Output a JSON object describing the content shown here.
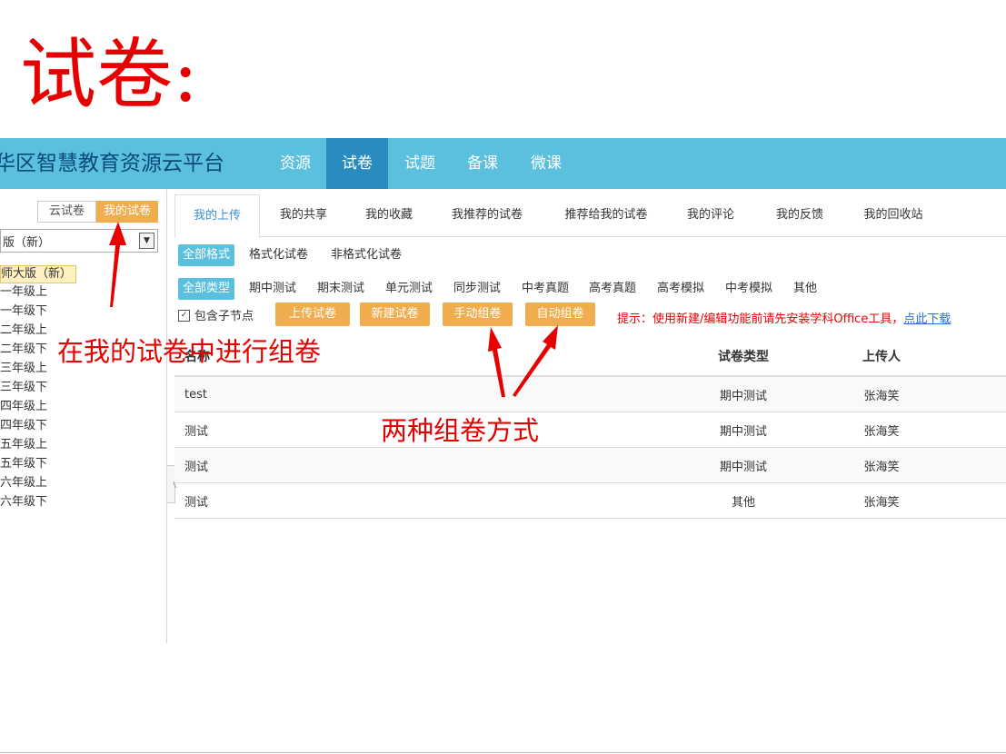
{
  "slide_title": "试卷:",
  "navbar": {
    "brand": "华区智慧教育资源云平台",
    "items": [
      "资源",
      "试卷",
      "试题",
      "备课",
      "微课"
    ],
    "active": "试卷"
  },
  "left_panel": {
    "seg_cloud": "云试卷",
    "seg_mine": "我的试卷",
    "version_select": "版（新）",
    "tree_root": "师大版（新）",
    "tree_items": [
      "一年级上",
      "一年级下",
      "二年级上",
      "二年级下",
      "三年级上",
      "三年级下",
      "四年级上",
      "四年级下",
      "五年级上",
      "五年级下",
      "六年级上",
      "六年级下"
    ],
    "collapse_glyph": "〈"
  },
  "tabs": [
    "我的上传",
    "我的共享",
    "我的收藏",
    "我推荐的试卷",
    "推荐给我的试卷",
    "我的评论",
    "我的反馈",
    "我的回收站"
  ],
  "format_filter": {
    "active": "全部格式",
    "options": [
      "格式化试卷",
      "非格式化试卷"
    ]
  },
  "type_filter": {
    "active": "全部类型",
    "options": [
      "期中测试",
      "期末测试",
      "单元测试",
      "同步测试",
      "中考真题",
      "高考真题",
      "高考模拟",
      "中考模拟",
      "其他"
    ]
  },
  "include_sub": {
    "checked_glyph": "✓",
    "label": "包含子节点"
  },
  "action_buttons": [
    "上传试卷",
    "新建试卷",
    "手动组卷",
    "自动组卷"
  ],
  "hint": {
    "text": "提示：使用新建/编辑功能前请先安装学科Office工具，",
    "link": "点此下载"
  },
  "table": {
    "headers": [
      "名称",
      "试卷类型",
      "上传人"
    ],
    "rows": [
      [
        "test",
        "期中测试",
        "张海笑"
      ],
      [
        "测试",
        "期中测试",
        "张海笑"
      ],
      [
        "测试",
        "期中测试",
        "张海笑"
      ],
      [
        "测试",
        "其他",
        "张海笑"
      ]
    ]
  },
  "annotations": {
    "left": "在我的试卷中进行组卷",
    "center": "两种组卷方式",
    "color": "#e60000"
  },
  "colors": {
    "navbar": "#5bc0de",
    "nav_active": "#2a8bbf",
    "orange": "#f0ad4e",
    "hint_red": "#e60000"
  }
}
